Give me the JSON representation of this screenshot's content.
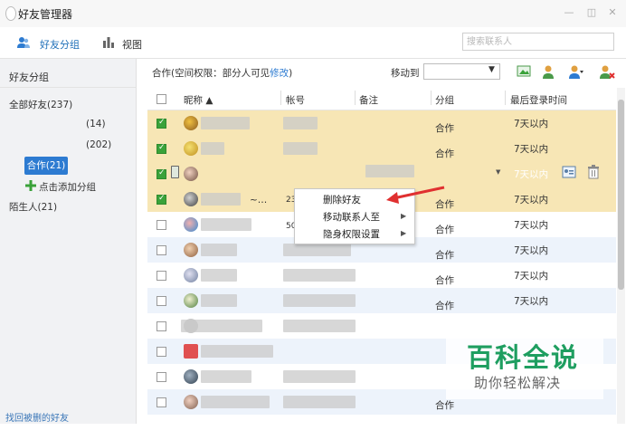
{
  "window": {
    "title": "好友管理器"
  },
  "toolbar": {
    "friend_group_label": "好友分组",
    "view_label": "视图"
  },
  "search": {
    "placeholder": "搜索联系人"
  },
  "sidebar": {
    "header": "好友分组",
    "all_friends": "全部好友(237)",
    "group_a": "(14)",
    "group_b": "(202)",
    "selected_group": "合作(21)",
    "add_group": "点击添加分组",
    "strangers": "陌生人(21)",
    "recover_link": "找回被删的好友"
  },
  "main": {
    "permission_prefix": "合作(空间权限：部分人可见",
    "permission_link": "修改",
    "permission_suffix": ")",
    "move_to_label": "移动到"
  },
  "table": {
    "columns": {
      "nickname": "昵称 ▲",
      "account": "帐号",
      "remark": "备注",
      "group": "分组",
      "last_login": "最后登录时间"
    },
    "group_value": "合作",
    "last_login_value": "7天以内",
    "row4_nick_suffix": "~…",
    "row4_account": "23",
    "row5_account": "50"
  },
  "context_menu": {
    "items": [
      "删除好友",
      "移动联系人至",
      "隐身权限设置"
    ]
  },
  "watermark": {
    "title": "百科全说",
    "subtitle": "助你轻松解决"
  },
  "colors": {
    "accent": "#2d7bd1",
    "selected_row": "#f7e6b5",
    "alt_row": "#edf3fb",
    "arrow": "#e03030",
    "watermark": "#1e9e60"
  }
}
